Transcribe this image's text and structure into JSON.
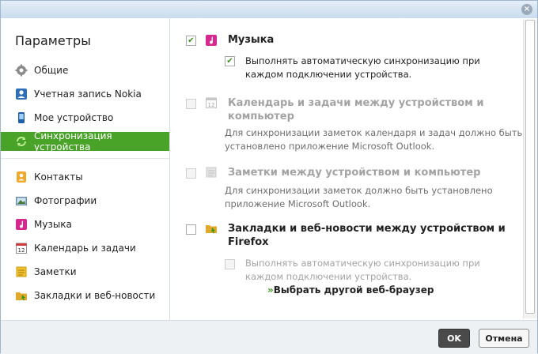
{
  "title": "Параметры",
  "sidebar": {
    "items": [
      {
        "label": "Общие",
        "icon": "gear-icon"
      },
      {
        "label": "Учетная запись Nokia",
        "icon": "user-icon"
      },
      {
        "label": "Мое устройство",
        "icon": "phone-icon"
      },
      {
        "label": "Синхронизация устройства",
        "icon": "sync-icon"
      },
      {
        "label": "Контакты",
        "icon": "contacts-icon"
      },
      {
        "label": "Фотографии",
        "icon": "photos-icon"
      },
      {
        "label": "Музыка",
        "icon": "music-icon"
      },
      {
        "label": "Календарь и задачи",
        "icon": "calendar-icon"
      },
      {
        "label": "Заметки",
        "icon": "notes-icon"
      },
      {
        "label": "Закладки и веб-новости",
        "icon": "bookmarks-icon"
      }
    ]
  },
  "sections": {
    "music": {
      "title": "Музыка",
      "checked": true,
      "option_line1": "Выполнять автоматическую синхронизацию при",
      "option_line2": "каждом подключении устройства.",
      "option_checked": true
    },
    "calendar": {
      "title_line1": "Календарь и задачи между устройством и",
      "title_line2": "компьютер",
      "checked": false,
      "desc_line1": "Для синхронизации заметок календаря и задач должно быть",
      "desc_line2": "установлено приложение Microsoft Outlook."
    },
    "notes": {
      "title": "Заметки между устройством и компьютер",
      "checked": false,
      "desc_line1": "Для синхронизации заметок должно быть установлено",
      "desc_line2": "приложение Microsoft Outlook."
    },
    "bookmarks": {
      "title_line1": "Закладки и веб-новости между устройством и",
      "title_line2": "Firefox",
      "checked": false,
      "option_line1": "Выполнять автоматическую синхронизацию при",
      "option_line2": "каждом подключении устройства.",
      "option_checked": false,
      "link_arrow": "»",
      "link": "Выбрать другой веб-браузер"
    }
  },
  "buttons": {
    "ok": "OK",
    "cancel": "Отмена"
  },
  "close_glyph": "×",
  "check_glyph": "✔",
  "colors": {
    "active_nav": "#4aa329",
    "accent_green": "#3a9a1e"
  }
}
